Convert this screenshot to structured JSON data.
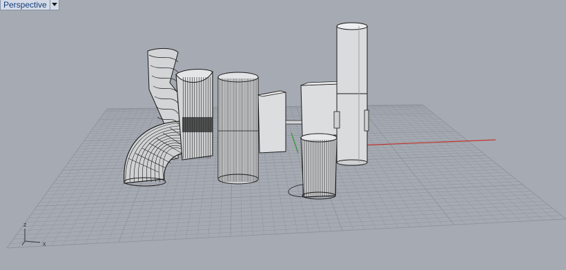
{
  "viewport": {
    "title": "Perspective",
    "menu_icon": "dropdown-arrow-icon"
  },
  "axes": {
    "z_label": "z",
    "x_label": "x"
  },
  "colors": {
    "background": "#a6aab2",
    "grid": "#8e939b",
    "x_axis": "#c0352b",
    "y_axis": "#2e9a37",
    "wire": "#1a1a1a",
    "surface": "#d6d7d9"
  }
}
